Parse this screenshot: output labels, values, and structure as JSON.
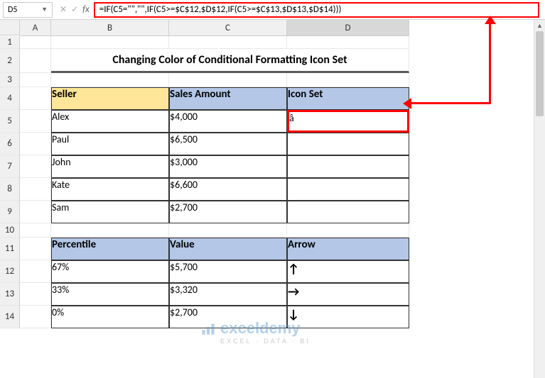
{
  "nameBox": "D5",
  "formula": "=IF(C5=\"\",\"\",IF(C5>=$C$12,$D$12,IF(C5>=$C$13,$D$13,$D$14)))",
  "columns": {
    "a": "A",
    "b": "B",
    "c": "C",
    "d": "D"
  },
  "rows": [
    "1",
    "2",
    "3",
    "4",
    "5",
    "6",
    "7",
    "8",
    "9",
    "10",
    "11",
    "12",
    "13",
    "14"
  ],
  "title": "Changing Color of Conditional Formatting Icon Set",
  "headers": {
    "seller": "Seller",
    "sales": "Sales Amount",
    "icon": "Icon Set",
    "percentile": "Percentile",
    "value": "Value",
    "arrow": "Arrow"
  },
  "sellers": [
    {
      "name": "Alex",
      "currency": "$",
      "amount": "4,000",
      "icon": "â"
    },
    {
      "name": "Paul",
      "currency": "$",
      "amount": "6,500",
      "icon": ""
    },
    {
      "name": "John",
      "currency": "$",
      "amount": "3,000",
      "icon": ""
    },
    {
      "name": "Kate",
      "currency": "$",
      "amount": "6,600",
      "icon": ""
    },
    {
      "name": "Sam",
      "currency": "$",
      "amount": "2,700",
      "icon": ""
    }
  ],
  "percentiles": [
    {
      "pct": "67%",
      "currency": "$",
      "value": "5,700",
      "arrow": "↑"
    },
    {
      "pct": "33%",
      "currency": "$",
      "value": "3,320",
      "arrow": "→"
    },
    {
      "pct": "0%",
      "currency": "$",
      "value": "2,700",
      "arrow": "↓"
    }
  ],
  "watermark": {
    "title": "exceldemy",
    "sub": "EXCEL · DATA · BI"
  }
}
